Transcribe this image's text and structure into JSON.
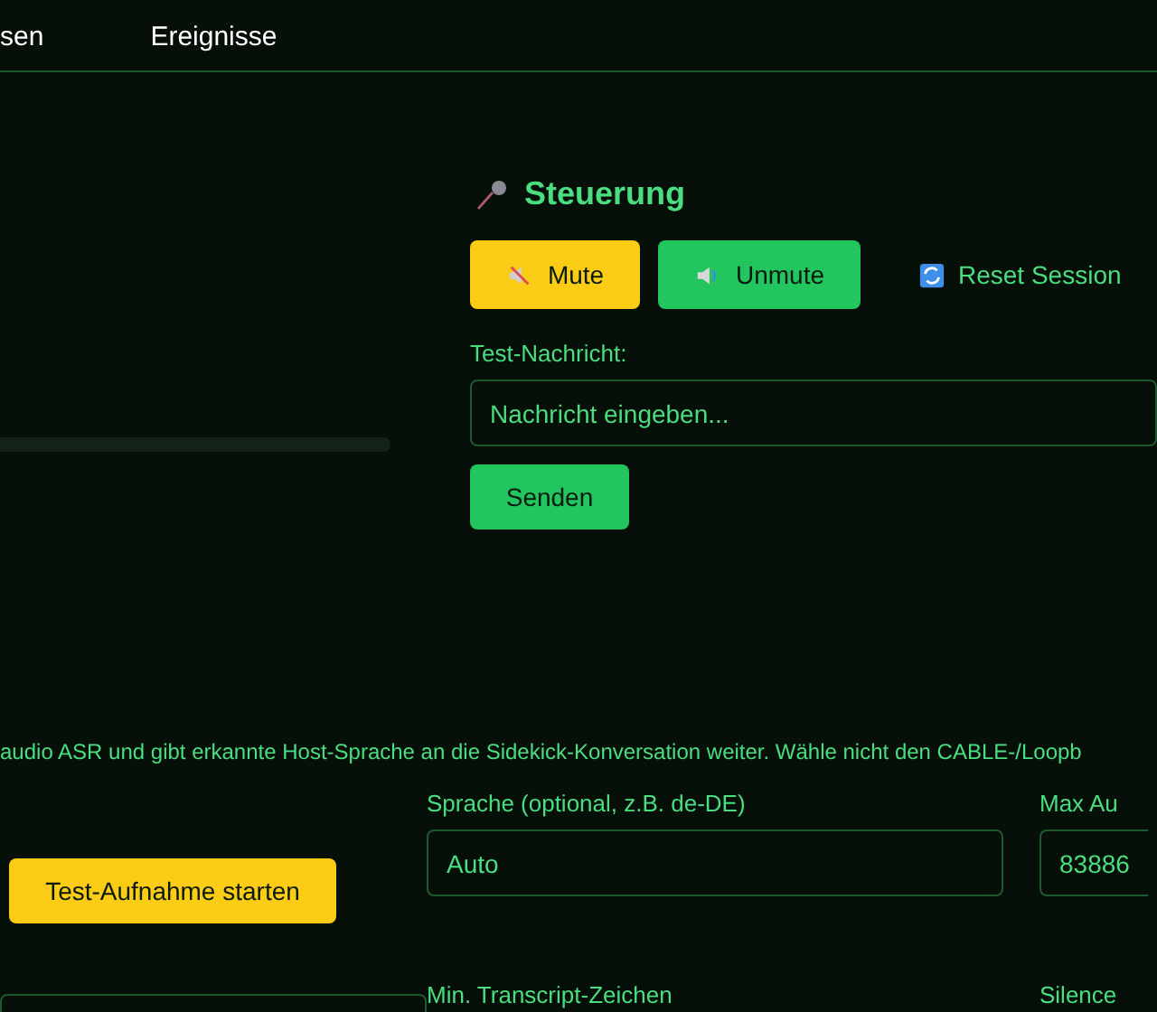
{
  "nav": {
    "tabs": [
      {
        "label": "sen",
        "selected": false
      },
      {
        "label": "Ereignisse",
        "selected": false
      }
    ]
  },
  "control": {
    "title": "Steuerung",
    "buttons": [
      {
        "kind": "mute",
        "label": "Mute"
      },
      {
        "kind": "unmute",
        "label": "Unmute"
      },
      {
        "kind": "reset",
        "label": "Reset Session"
      }
    ],
    "message_label": "Test-Nachricht:",
    "message_field": {
      "placeholder": "Nachricht eingeben..."
    },
    "send_button": "Senden"
  },
  "asr": {
    "description": "audio ASR und gibt erkannte Host-Sprache an die Sidekick-Konversation weiter. Wähle nicht den CABLE-/Loopb",
    "test_button": "Test-Aufnahme starten",
    "fields": [
      {
        "label": "Sprache (optional, z.B. de-DE)",
        "value": "Auto"
      },
      {
        "label": "Max Au",
        "value": "83886"
      },
      {
        "label": "Min. Transcript-Zeichen"
      },
      {
        "label": "Silence"
      }
    ]
  }
}
